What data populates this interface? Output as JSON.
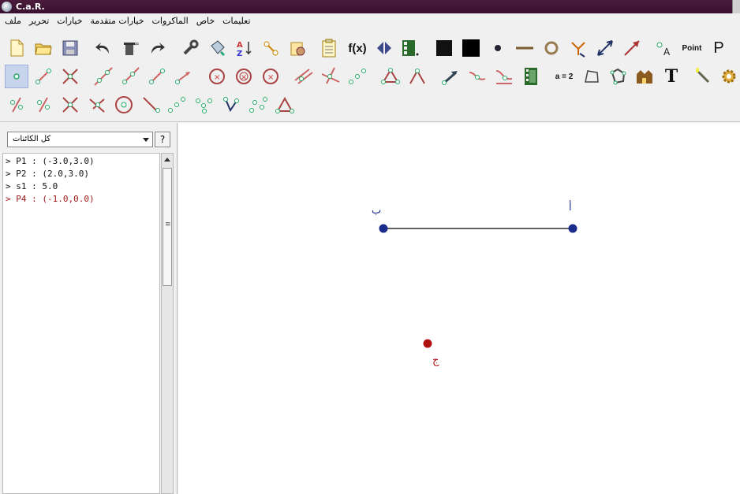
{
  "window": {
    "title": "C.a.R."
  },
  "menu": {
    "items": [
      "ملف",
      "تحرير",
      "خيارات",
      "خيارات متقدمة",
      "الماكروات",
      "خاص",
      "تعليمات"
    ]
  },
  "toolbar": {
    "text_tools": {
      "function": "f(x)",
      "point_label": "Point",
      "p_letter": "P",
      "assign": "a = 2",
      "text": "T"
    }
  },
  "panel": {
    "filter": "كل الكائنات",
    "help_label": "?",
    "objects": [
      {
        "text": "> P1 : (-3.0,3.0)",
        "color": "#111111"
      },
      {
        "text": "> P2 : (2.0,3.0)",
        "color": "#111111"
      },
      {
        "text": "> s1 : 5.0",
        "color": "#111111"
      },
      {
        "text": "> P4 : (-1.0,0.0)",
        "color": "#9b1818"
      }
    ]
  },
  "canvas": {
    "points": [
      {
        "label": "أ",
        "color": "#1a2d8c"
      },
      {
        "label": "ب",
        "color": "#1a2d8c"
      },
      {
        "label": "ج",
        "color": "#b01010"
      }
    ]
  },
  "colors": {
    "accent": "#4a1c3c",
    "blue_point": "#1a2d8c",
    "red_point": "#b01010"
  }
}
